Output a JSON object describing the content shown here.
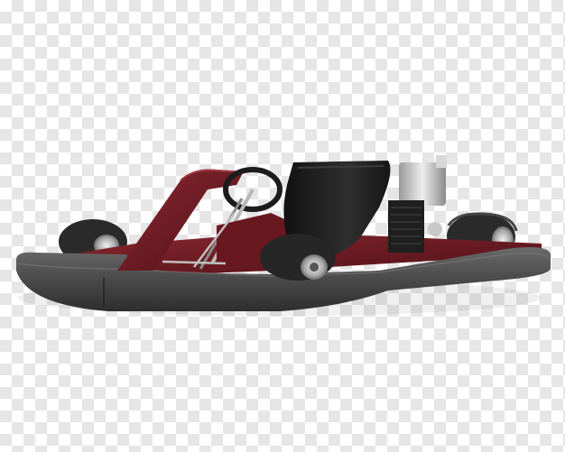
{
  "scene": {
    "subject": "go-kart",
    "background": "transparency-checkerboard",
    "colors": {
      "checker_light": "#ffffff",
      "checker_dark": "#e6e6e6",
      "body_red": "#6e1a22",
      "bumper": "#4a4a4a",
      "tire": "#2b2b2b",
      "seat": "#1e1e1e",
      "metal": "#c9c9c9"
    }
  }
}
